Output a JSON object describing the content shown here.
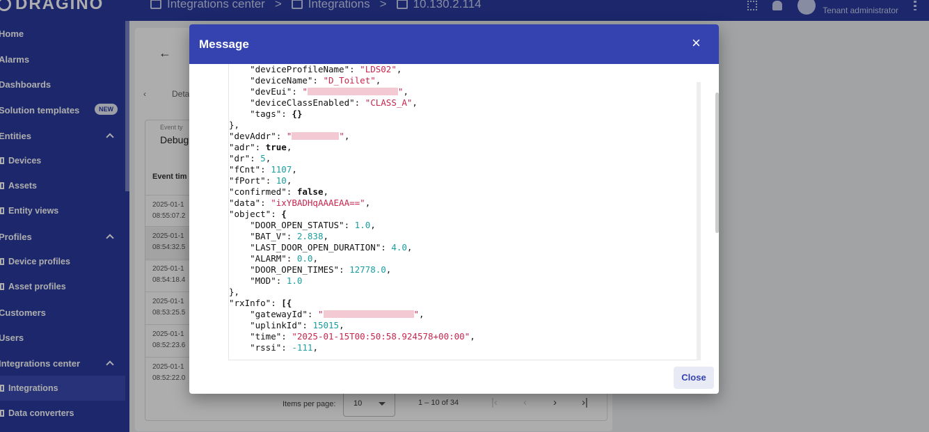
{
  "topbar": {
    "logo_text": "DRAGINO",
    "breadcrumb": [
      "Integrations center",
      "Integrations",
      "10.130.2.114"
    ],
    "breadcrumb_sep": ">",
    "user_role": "Tenant administrator"
  },
  "sidebar": {
    "items": [
      {
        "label": "Home"
      },
      {
        "label": "Alarms"
      },
      {
        "label": "Dashboards"
      },
      {
        "label": "Solution templates",
        "badge": "NEW"
      },
      {
        "label": "Entities"
      },
      {
        "label": "Devices"
      },
      {
        "label": "Assets"
      },
      {
        "label": "Entity views"
      },
      {
        "label": "Profiles"
      },
      {
        "label": "Device profiles"
      },
      {
        "label": "Asset profiles"
      },
      {
        "label": "Customers"
      },
      {
        "label": "Users"
      },
      {
        "label": "Integrations center"
      },
      {
        "label": "Integrations"
      },
      {
        "label": "Data converters"
      }
    ]
  },
  "main": {
    "tab_partial": "Deta",
    "event_type_label": "Event ty",
    "event_type_value": "Debug",
    "event_time_header": "Event tim",
    "rows": [
      {
        "date": "2025-01-1",
        "time": "08:55:07.2"
      },
      {
        "date": "2025-01-1",
        "time": "08:54:32.5"
      },
      {
        "date": "2025-01-1",
        "time": "08:54:18.4"
      },
      {
        "date": "2025-01-1",
        "time": "08:53:25.5"
      },
      {
        "date": "2025-01-1",
        "time": "08:52:23.6"
      },
      {
        "date": "2025-01-1",
        "time": "08:52:22.0"
      }
    ],
    "pagination": {
      "items_per_page_label": "Items per page:",
      "page_size": "10",
      "range": "1 – 10 of 34"
    }
  },
  "dialog": {
    "title": "Message",
    "close_icon": "×",
    "close_label": "Close",
    "code": {
      "l1": {
        "k": "\"deviceProfileName\"",
        "v": "\"LDS02\""
      },
      "l2": {
        "k": "\"deviceName\"",
        "v": "\"D_Toilet\""
      },
      "l3": {
        "k": "\"devEui\""
      },
      "l4": {
        "k": "\"deviceClassEnabled\"",
        "v": "\"CLASS_A\""
      },
      "l5": {
        "k": "\"tags\"",
        "v": "{}"
      },
      "l7": {
        "k": "\"devAddr\""
      },
      "l8": {
        "k": "\"adr\"",
        "v": "true"
      },
      "l9": {
        "k": "\"dr\"",
        "v": "5"
      },
      "l10": {
        "k": "\"fCnt\"",
        "v": "1107"
      },
      "l11": {
        "k": "\"fPort\"",
        "v": "10"
      },
      "l12": {
        "k": "\"confirmed\"",
        "v": "false"
      },
      "l13": {
        "k": "\"data\"",
        "v": "\"ixYBADHqAAAEAA==\""
      },
      "l14": {
        "k": "\"object\""
      },
      "l15": {
        "k": "\"DOOR_OPEN_STATUS\"",
        "v": "1.0"
      },
      "l16": {
        "k": "\"BAT_V\"",
        "v": "2.838"
      },
      "l17": {
        "k": "\"LAST_DOOR_OPEN_DURATION\"",
        "v": "4.0"
      },
      "l18": {
        "k": "\"ALARM\"",
        "v": "0.0"
      },
      "l19": {
        "k": "\"DOOR_OPEN_TIMES\"",
        "v": "12778.0"
      },
      "l20": {
        "k": "\"MOD\"",
        "v": "1.0"
      },
      "l22": {
        "k": "\"rxInfo\""
      },
      "l23": {
        "k": "\"gatewayId\""
      },
      "l24": {
        "k": "\"uplinkId\"",
        "v": "15015"
      },
      "l25": {
        "k": "\"time\"",
        "v": "\"2025-01-15T00:50:58.924578+00:00\""
      },
      "l26": {
        "k": "\"rssi\"",
        "v": "-111"
      }
    }
  }
}
